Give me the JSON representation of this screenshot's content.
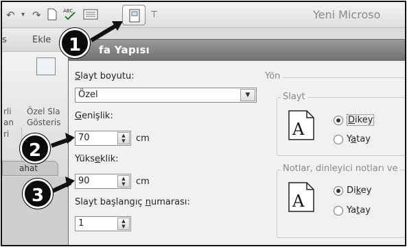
{
  "window": {
    "title": "Yeni Microso"
  },
  "ribbon": {
    "tabs": [
      "s",
      "Ekle"
    ],
    "side_text": [
      "rli",
      "an",
      "ri",
      "Özel Sla",
      "Gösteris"
    ],
    "active_tab_chip": "ahat"
  },
  "dialog": {
    "title": "fa Yapısı",
    "slide_size": {
      "label_u": "S",
      "label_rest": "layt boyutu:",
      "value": "Özel"
    },
    "width": {
      "label_u": "G",
      "label_rest": "enişlik:",
      "value": "70",
      "unit": "cm"
    },
    "height": {
      "label_pre": "Yüks",
      "label_u": "e",
      "label_post": "klik:",
      "value": "90",
      "unit": "cm"
    },
    "start_number": {
      "label_pre": "Slayt başlangıç ",
      "label_u": "n",
      "label_post": "umarası:",
      "value": "1"
    },
    "orientation": {
      "group_label": "Yön",
      "slides": {
        "label": "Slayt",
        "portrait": {
          "u": "D",
          "rest": "ikey"
        },
        "landscape": {
          "pre": "Y",
          "u": "a",
          "post": "tay"
        },
        "selected": "portrait"
      },
      "notes": {
        "label": "Notlar, dinleyici notları ve",
        "portrait": {
          "pre": "Di",
          "u": "k",
          "post": "ey"
        },
        "landscape": {
          "pre": "Ya",
          "u": "t",
          "post": "ay"
        },
        "selected": "portrait"
      }
    }
  },
  "callouts": [
    "1",
    "2",
    "3"
  ],
  "icons": {
    "undo": "undo-icon",
    "redo": "redo-icon",
    "spelling": "spelling-icon",
    "page_setup": "page-setup-icon",
    "customize": "customize-qat-icon"
  }
}
